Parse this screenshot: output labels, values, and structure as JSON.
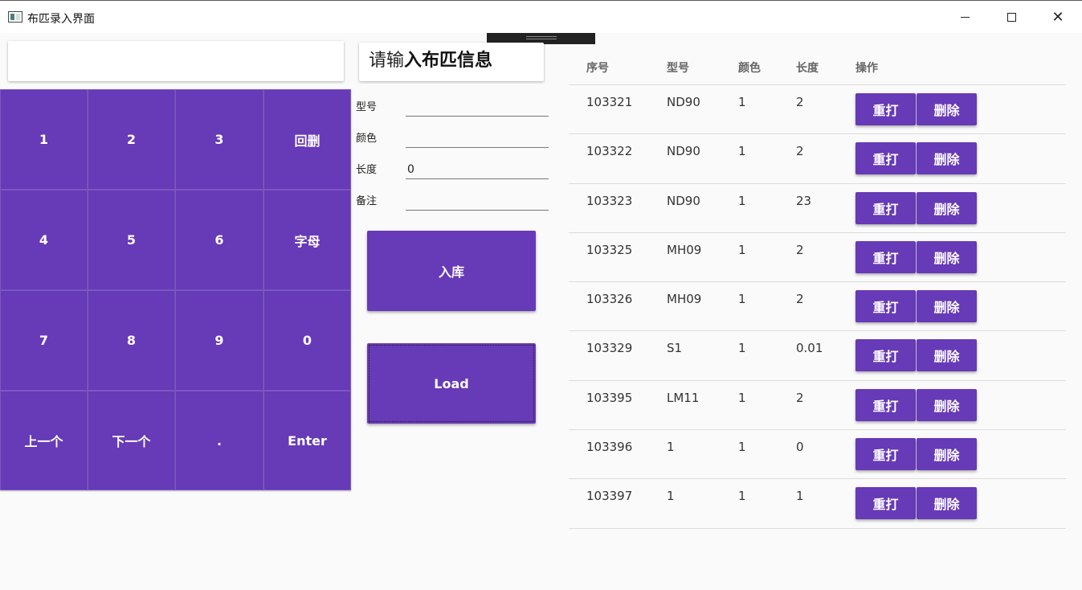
{
  "window": {
    "title": "布匹录入界面",
    "minimize_glyph": "",
    "maximize_glyph": "",
    "close_glyph": "✕"
  },
  "display": {
    "value": ""
  },
  "prompt": {
    "normal": "请输",
    "bold": "入布匹信息"
  },
  "keypad": {
    "keys": [
      "1",
      "2",
      "3",
      "回删",
      "4",
      "5",
      "6",
      "字母",
      "7",
      "8",
      "9",
      "0",
      "上一个",
      "下一个",
      ".",
      "Enter"
    ]
  },
  "form": {
    "model_label": "型号",
    "model_value": "",
    "color_label": "颜色",
    "color_value": "",
    "length_label": "长度",
    "length_value": "0",
    "note_label": "备注",
    "note_value": ""
  },
  "buttons": {
    "store": "入库",
    "load": "Load"
  },
  "table": {
    "headers": [
      "序号",
      "型号",
      "颜色",
      "长度",
      "操作"
    ],
    "reprint_label": "重打",
    "delete_label": "删除",
    "rows": [
      {
        "id": "103321",
        "model": "ND90",
        "color": "1",
        "length": "2"
      },
      {
        "id": "103322",
        "model": "ND90",
        "color": "1",
        "length": "2"
      },
      {
        "id": "103323",
        "model": "ND90",
        "color": "1",
        "length": "23"
      },
      {
        "id": "103325",
        "model": "MH09",
        "color": "1",
        "length": "2"
      },
      {
        "id": "103326",
        "model": "MH09",
        "color": "1",
        "length": "2"
      },
      {
        "id": "103329",
        "model": "S1",
        "color": "1",
        "length": "0.01"
      },
      {
        "id": "103395",
        "model": "LM11",
        "color": "1",
        "length": "2"
      },
      {
        "id": "103396",
        "model": "1",
        "color": "1",
        "length": "0"
      },
      {
        "id": "103397",
        "model": "1",
        "color": "1",
        "length": "1"
      }
    ]
  },
  "colors": {
    "accent": "#673ab7",
    "background": "#fafafa"
  }
}
